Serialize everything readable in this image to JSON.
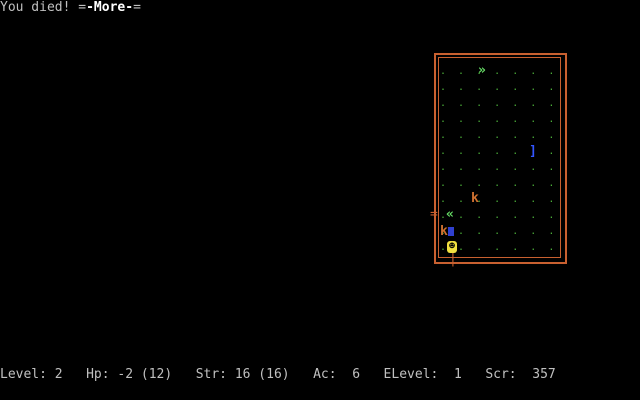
{
  "message": {
    "text": "You died! =",
    "more": "-More-",
    "tail": "="
  },
  "map": {
    "floor_rows": [
      ".  .  .  .  .  .  .  .  .  .  .  .  .  .  .  .  .  .  .",
      ".  .  .  .  .  .  .  .  .  .  .  .  .  .  .  .  .  .  .",
      ".  .  .  .  .  .  .  .  .  .  .  .  .  .  .  .  .  .  .",
      ".  .  .  .  .  .  .  .  .  .  .  .  .  .  .  .  .  .  .",
      ".  .  .  .  .  .  .  .  .  .  .  .  .  .  .  .  .  .  .",
      ".  .  .  .  .  .  .  .  .  .  .  .  .  .  .  .  .  .  .",
      ".  .  .  .  .  .  .  .  .  .  .  .  .  .  .  .  .  .  .",
      ".  .  .  .  .  .  .  .  .  .  .  .  .  .  .  .  .  .  .",
      ".  .  .  .  .  .  .  .  .  .  .  .  .  .  .  .  .  .  .",
      ".  .  .  .  .  .  .  .  .  .  .  .  .  .  .  .  .  .  .",
      ".  .  .  .  .  .  .  .  .  .  .  .  .  .  .  .  .  .  .",
      ".  .  .  .  .  .  .  .  .  .  .  .  .  .  .  .  .  .  ."
    ],
    "glyphs": {
      "stairs_up": "»",
      "item": "]",
      "monster": "k",
      "stairs_down": "«",
      "door_h": "=",
      "door_v": "|",
      "player": "☻"
    },
    "colors": {
      "wall": "#c86030",
      "floor": "#4caf3a",
      "stairs": "#66dd66",
      "item": "#3355ff",
      "monster": "#d07030",
      "player": "#f0e040"
    }
  },
  "status": {
    "level": "Level: 2",
    "hp": "Hp: -2 (12)",
    "str": "Str: 16 (16)",
    "ac": "Ac:  6",
    "elevel": "ELevel:  1",
    "score": "Scr:  357"
  }
}
